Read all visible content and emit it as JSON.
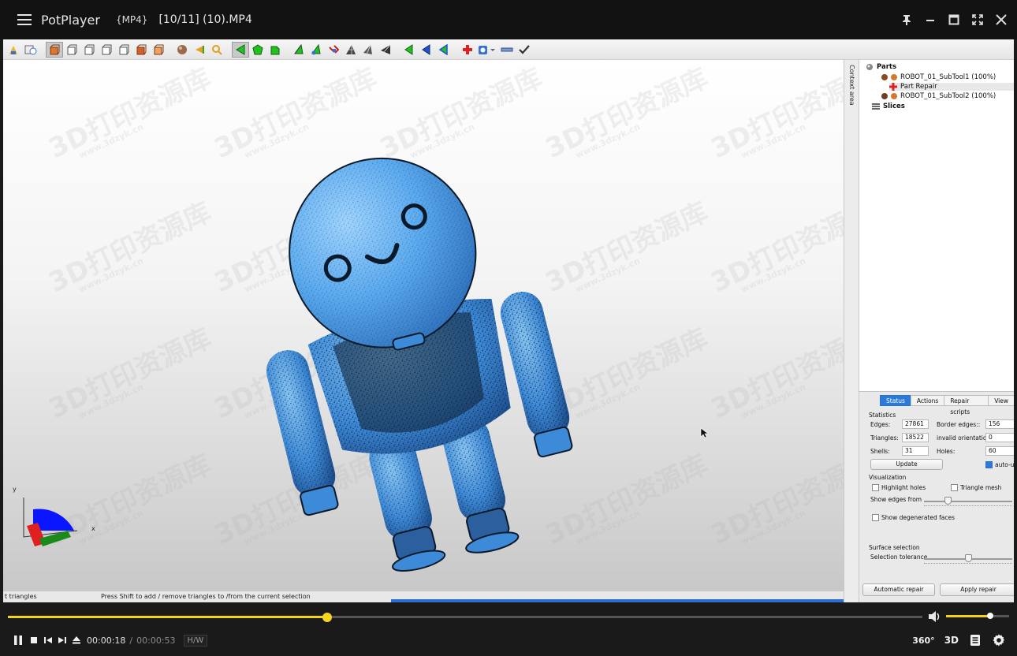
{
  "titlebar": {
    "app_name": "PotPlayer",
    "format": "{MP4}",
    "file_title": "[10/11] (10).MP4"
  },
  "app": {
    "context_area_label": "Context area",
    "status_left": "t triangles",
    "status_mid": "Press Shift to add / remove triangles to /from the current selection",
    "watermark": "3D打印资源库",
    "watermark_url": "www.3dzyk.cn"
  },
  "tree": {
    "parts_label": "Parts",
    "item1": "ROBOT_01_SubTool1 (100%)",
    "item2": "Part Repair",
    "item3": "ROBOT_01_SubTool2 (100%)",
    "slices_label": "Slices"
  },
  "props": {
    "tabs": [
      "Status",
      "Actions",
      "Repair scripts",
      "View"
    ],
    "statistics_label": "Statistics",
    "edges_label": "Edges:",
    "edges_value": "27861",
    "border_edges_label": "Border edges::",
    "border_edges_value": "156",
    "triangles_label": "Triangles:",
    "triangles_value": "18522",
    "invalid_orient_label": "invalid orientation",
    "invalid_orient_value": "0",
    "shells_label": "Shells:",
    "shells_value": "31",
    "holes_label": "Holes:",
    "holes_value": "60",
    "update_label": "Update",
    "auto_update_label": "auto-up",
    "visualization_label": "Visualization",
    "highlight_holes_label": "Highlight holes",
    "triangle_mesh_label": "Triangle mesh",
    "show_edges_from_label": "Show edges from",
    "show_degenerated_label": "Show degenerated faces",
    "surface_selection_label": "Surface selection",
    "selection_tolerance_label": "Selection tolerance",
    "automatic_repair_label": "Automatic repair",
    "apply_repair_label": "Apply repair"
  },
  "player": {
    "time_current": "00:00:18",
    "time_separator": "/",
    "time_total": "00:00:53",
    "hw_label": "H/W",
    "label_360": "360°",
    "label_3d": "3D",
    "seek_fraction": 0.3491,
    "volume_fraction": 0.7,
    "accent_color": "#f2d21b"
  }
}
